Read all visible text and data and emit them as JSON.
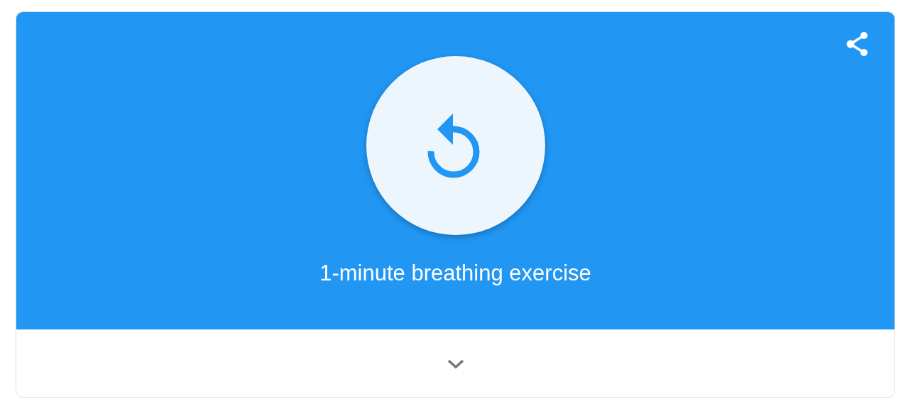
{
  "exercise": {
    "title": "1-minute breathing exercise"
  }
}
